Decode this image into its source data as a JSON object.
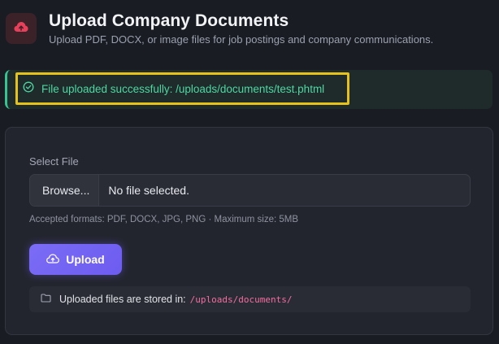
{
  "header": {
    "title": "Upload Company Documents",
    "subtitle": "Upload PDF, DOCX, or image files for job postings and company communications.",
    "icon": "cloud-upload-icon",
    "icon_color": "#e8405a"
  },
  "alert": {
    "type": "success",
    "icon": "check-circle-icon",
    "message": "File uploaded successfully: /uploads/documents/test.phtml",
    "color": "#4fd6a2"
  },
  "form": {
    "field_label": "Select File",
    "browse_label": "Browse...",
    "file_status": "No file selected.",
    "help_text": "Accepted formats: PDF, DOCX, JPG, PNG · Maximum size: 5MB",
    "upload_label": "Upload",
    "upload_icon": "cloud-upload-icon",
    "accent_color": "#7b6cf6"
  },
  "storage": {
    "icon": "folder-icon",
    "label": "Uploaded files are stored in:",
    "path": "/uploads/documents/"
  }
}
